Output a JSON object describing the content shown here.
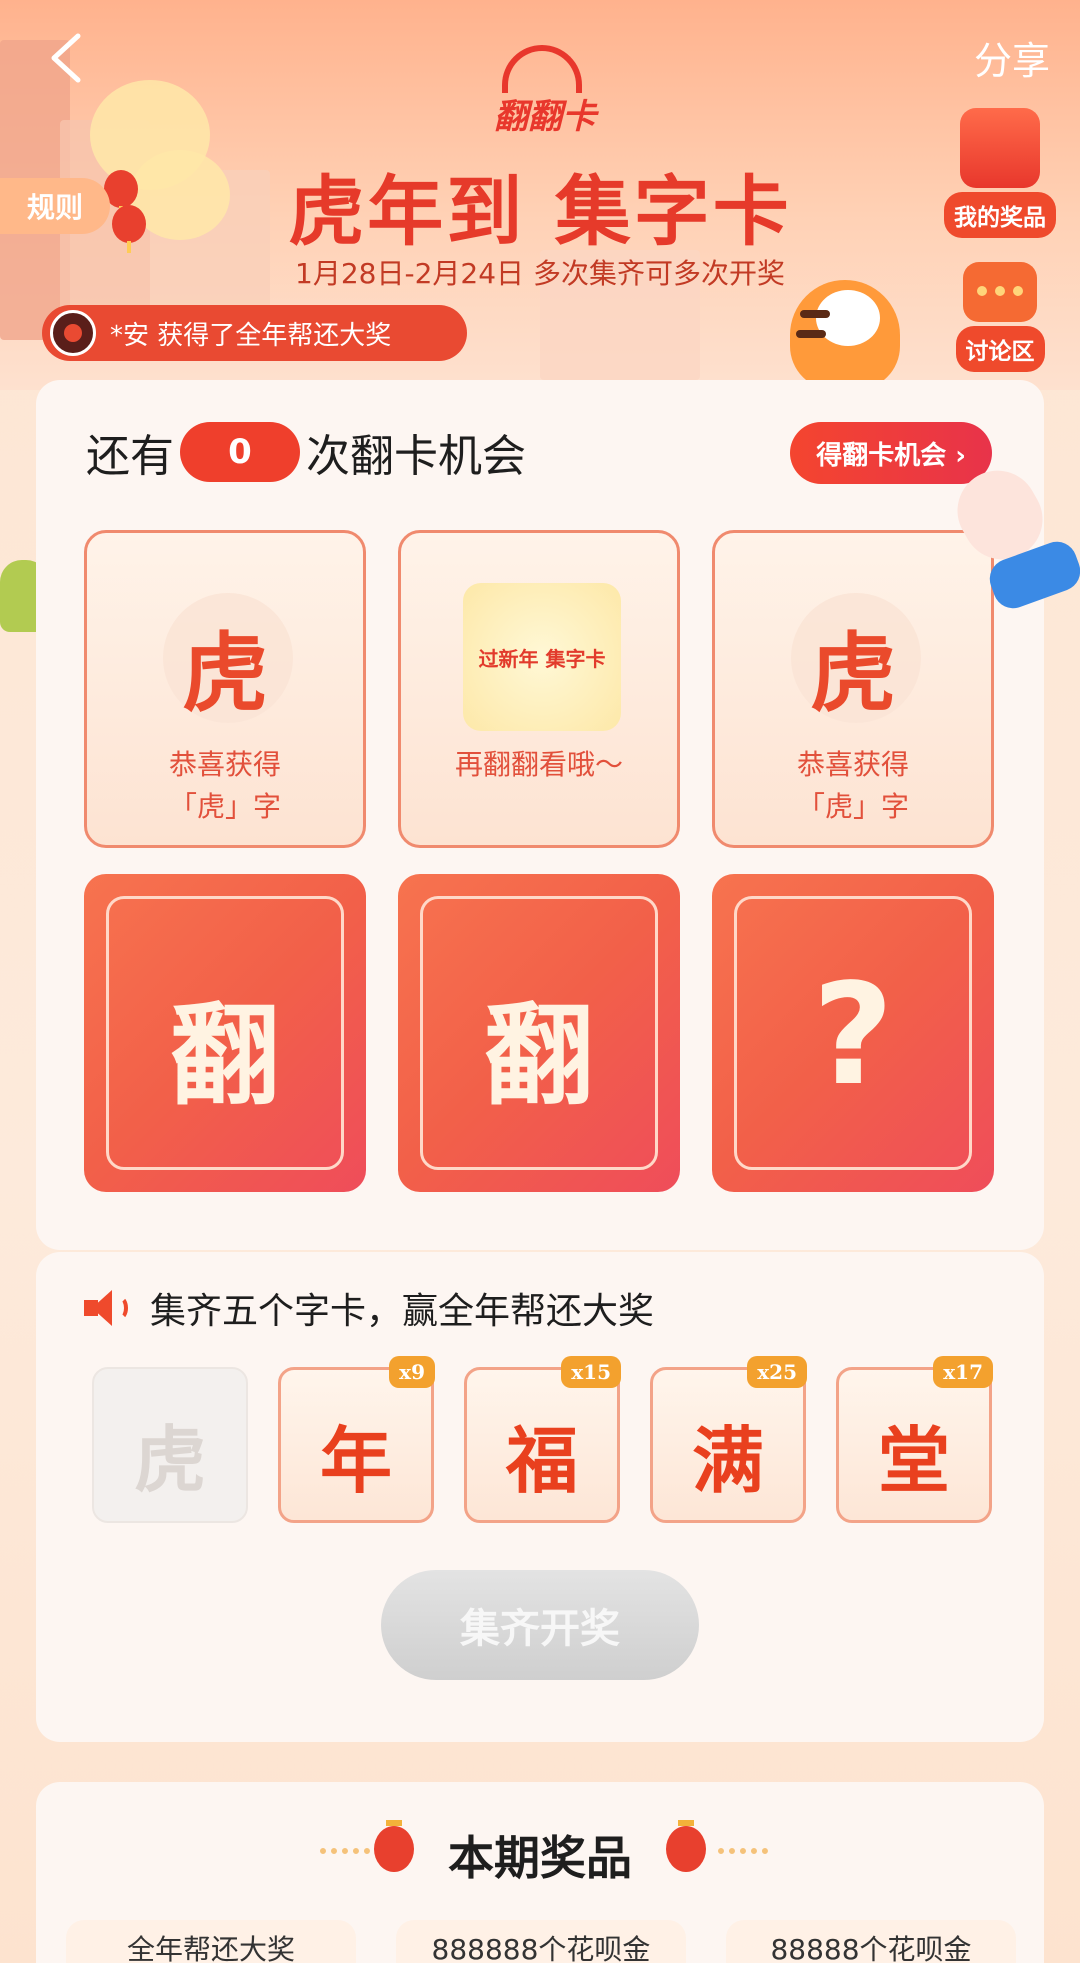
{
  "header": {
    "back_label": "<",
    "share_label": "分享",
    "logo_text": "翻翻卡",
    "title": "虎年到 集字卡",
    "subtitle": "1月28日-2月24日  多次集齐可多次开奖",
    "rules_label": "规则",
    "ticker_text": "*安  获得了全年帮还大奖",
    "my_prizes_label": "我的奖品",
    "discussion_label": "讨论区"
  },
  "flip": {
    "prefix": "还有",
    "chances": "0",
    "suffix": "次翻卡机会",
    "get_chance_label": "得翻卡机会 ›",
    "opened_cards": [
      {
        "char": "虎",
        "line1": "恭喜获得",
        "line2": "「虎」字"
      },
      {
        "mini_text": "过新年 集字卡",
        "line1": "再翻翻看哦～"
      },
      {
        "char": "虎",
        "line1": "恭喜获得",
        "line2": "「虎」字"
      }
    ],
    "back_cards": [
      {
        "char": "翻"
      },
      {
        "char": "翻"
      },
      {
        "char": "?"
      }
    ]
  },
  "collect": {
    "notice": "集齐五个字卡，赢全年帮还大奖",
    "slots": [
      {
        "char": "虎",
        "badge": "",
        "collected": false
      },
      {
        "char": "年",
        "badge": "x9",
        "collected": true
      },
      {
        "char": "福",
        "badge": "x15",
        "collected": true
      },
      {
        "char": "满",
        "badge": "x25",
        "collected": true
      },
      {
        "char": "堂",
        "badge": "x17",
        "collected": true
      }
    ],
    "draw_label": "集齐开奖"
  },
  "prizes": {
    "title": "本期奖品",
    "items": [
      "全年帮还大奖",
      "888888个花呗金",
      "88888个花呗金"
    ]
  },
  "colors": {
    "accent": "#ef3f2c",
    "card_back": "#f26049",
    "disabled": "#d9d9d9"
  }
}
